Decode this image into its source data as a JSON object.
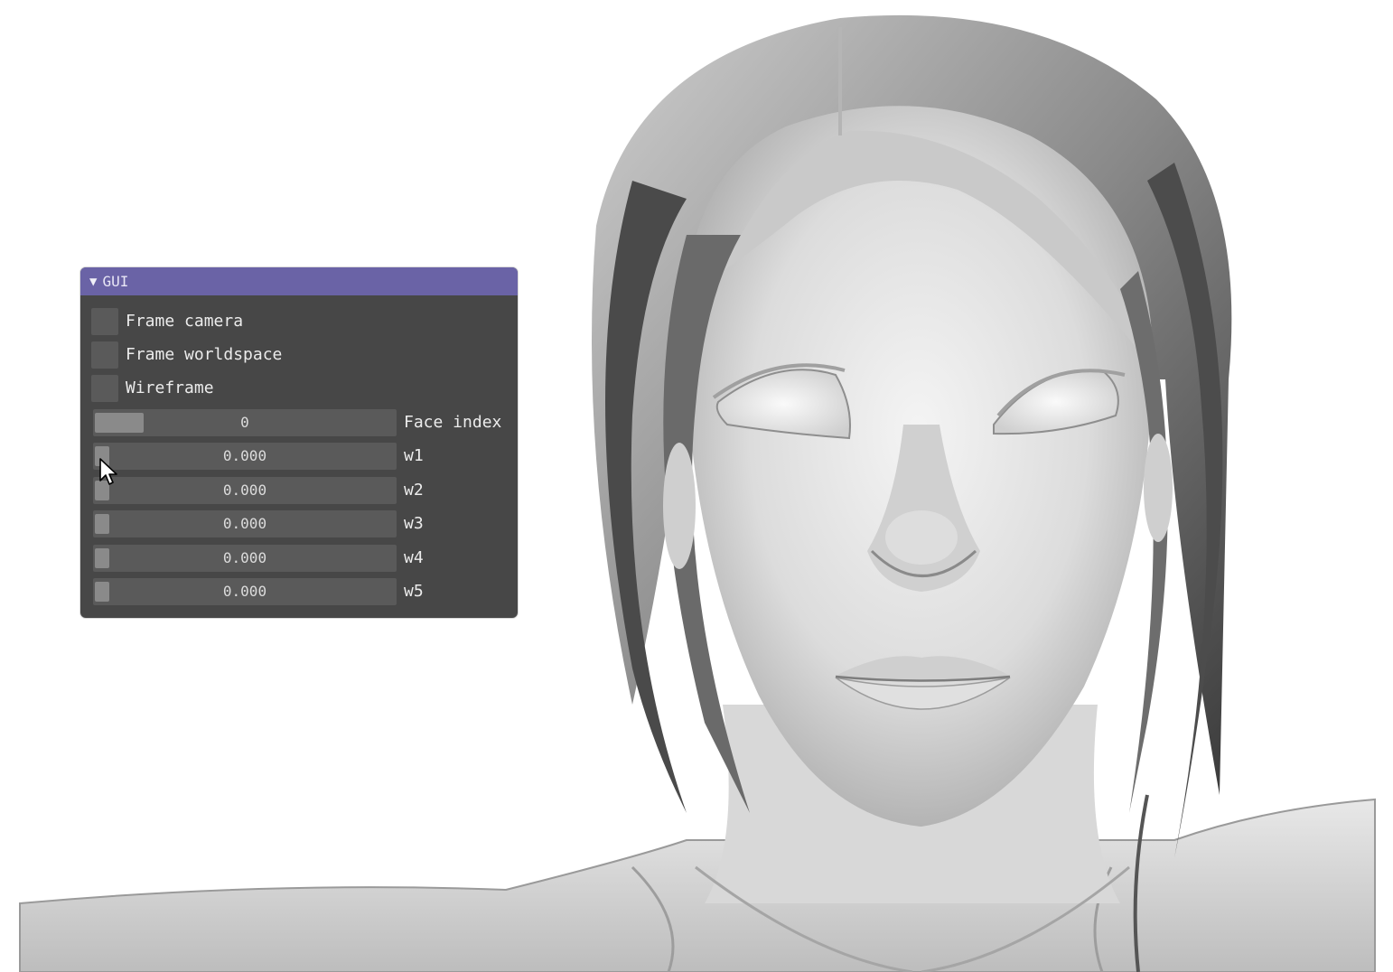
{
  "window": {
    "title": "GUI",
    "collapse_icon": "triangle-down-icon",
    "title_color": "#6a63a6",
    "bg_color": "#474747"
  },
  "checkboxes": [
    {
      "label": "Frame camera",
      "checked": false
    },
    {
      "label": "Frame worldspace",
      "checked": false
    },
    {
      "label": "Wireframe",
      "checked": false
    }
  ],
  "sliders": [
    {
      "label": "Face index",
      "value": "0",
      "fraction": 0.0
    },
    {
      "label": "w1",
      "value": "0.000",
      "fraction": 0.0
    },
    {
      "label": "w2",
      "value": "0.000",
      "fraction": 0.0
    },
    {
      "label": "w3",
      "value": "0.000",
      "fraction": 0.0
    },
    {
      "label": "w4",
      "value": "0.000",
      "fraction": 0.0
    },
    {
      "label": "w5",
      "value": "0.000",
      "fraction": 0.0
    }
  ],
  "cursor_icon": "arrow-cursor-icon"
}
